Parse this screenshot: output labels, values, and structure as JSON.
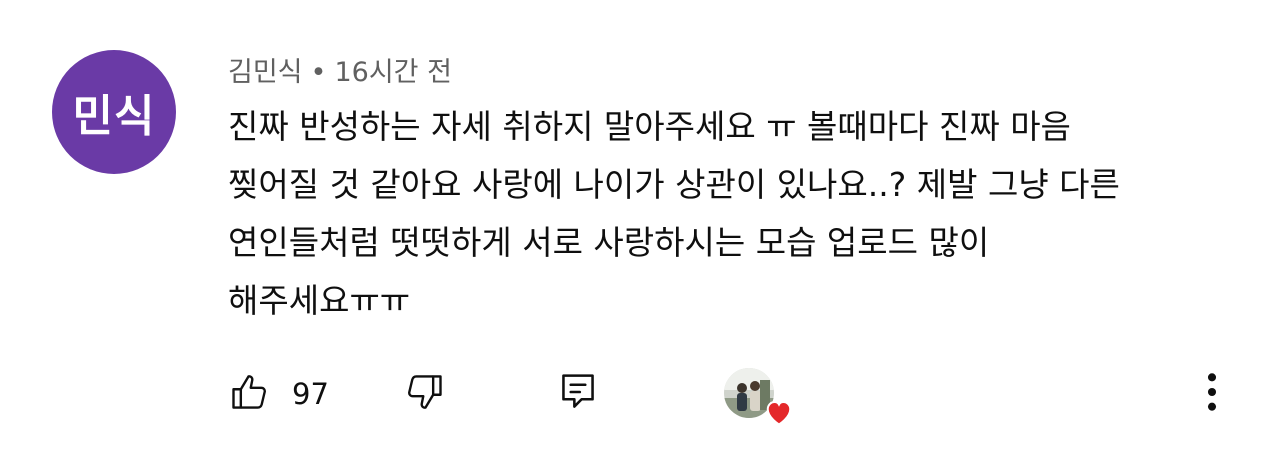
{
  "comment": {
    "avatar_text": "민식",
    "avatar_color": "#6a3aa6",
    "author": "김민식",
    "separator": "•",
    "time": "16시간 전",
    "lines": [
      "진짜 반성하는 자세 취하지 말아주세요 ㅠ 볼때마다 진짜 마음",
      "찢어질 것 같아요 사랑에 나이가 상관이 있나요..? 제발 그냥 다른",
      "연인들처럼 떳떳하게 서로 사랑하시는 모습 업로드 많이",
      "해주세요ㅠㅠ"
    ]
  },
  "actions": {
    "like_icon": "thumbs-up-icon",
    "like_count": "97",
    "dislike_icon": "thumbs-down-icon",
    "reply_icon": "reply-icon",
    "creator_heart_icon": "heart-icon",
    "heart_color": "#e4282a",
    "more_icon": "more-vertical-icon"
  }
}
